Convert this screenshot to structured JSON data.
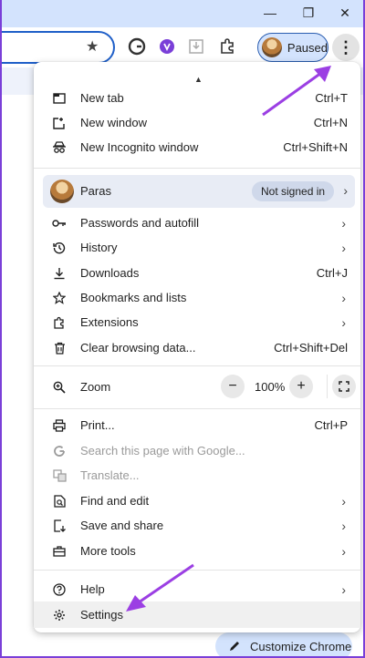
{
  "window": {
    "minimize_label": "—",
    "restore_label": "❐",
    "close_label": "✕"
  },
  "toolbar": {
    "star_icon": "★",
    "profile_label": "Paused",
    "menu_icon": "⋮"
  },
  "menu": {
    "group1": [
      {
        "label": "New tab",
        "shortcut": "Ctrl+T",
        "icon": "new-tab-icon"
      },
      {
        "label": "New window",
        "shortcut": "Ctrl+N",
        "icon": "new-window-icon"
      },
      {
        "label": "New Incognito window",
        "shortcut": "Ctrl+Shift+N",
        "icon": "incognito-icon"
      }
    ],
    "profile": {
      "name": "Paras",
      "status": "Not signed in"
    },
    "group2": [
      {
        "label": "Passwords and autofill",
        "icon": "key-icon"
      },
      {
        "label": "History",
        "icon": "history-icon"
      },
      {
        "label": "Downloads",
        "shortcut": "Ctrl+J",
        "icon": "download-icon"
      },
      {
        "label": "Bookmarks and lists",
        "icon": "star-icon"
      },
      {
        "label": "Extensions",
        "icon": "puzzle-icon"
      },
      {
        "label": "Clear browsing data...",
        "shortcut": "Ctrl+Shift+Del",
        "icon": "trash-icon"
      }
    ],
    "zoom": {
      "label": "Zoom",
      "value": "100%",
      "minus": "−",
      "plus": "+"
    },
    "group3": [
      {
        "label": "Print...",
        "shortcut": "Ctrl+P",
        "icon": "print-icon"
      },
      {
        "label": "Search this page with Google...",
        "icon": "google-icon"
      },
      {
        "label": "Translate...",
        "icon": "translate-icon"
      },
      {
        "label": "Find and edit",
        "icon": "find-icon"
      },
      {
        "label": "Save and share",
        "icon": "save-icon"
      },
      {
        "label": "More tools",
        "icon": "toolbox-icon"
      }
    ],
    "group4": [
      {
        "label": "Help",
        "icon": "help-icon"
      },
      {
        "label": "Settings",
        "icon": "gear-icon"
      }
    ]
  },
  "page": {
    "customize_label": "Customize Chrome"
  },
  "colors": {
    "accent": "#d3e3fd",
    "annotation_arrow": "#9b3fe3"
  }
}
